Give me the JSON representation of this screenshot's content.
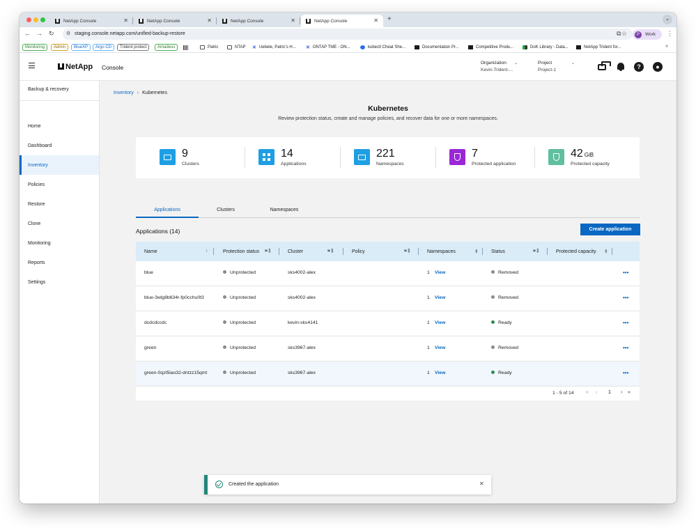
{
  "browser": {
    "tabs": [
      {
        "title": "NetApp Console"
      },
      {
        "title": "NetApp Console"
      },
      {
        "title": "NetApp Console"
      },
      {
        "title": "NetApp Console"
      }
    ],
    "url": "staging.console.netapp.com/unified-backup-restore",
    "profile_label": "Work",
    "profile_initial": "P",
    "bookmarks": [
      {
        "label": "Monitoring",
        "color": "#2e7d32"
      },
      {
        "label": "Admin",
        "color": "#b8860b"
      },
      {
        "label": "BlueXP",
        "color": "#1565c0"
      },
      {
        "label": "Argo CD",
        "color": "#1565c0"
      },
      {
        "label": "Trident protect",
        "color": "#444444"
      },
      {
        "label": "Amadeus",
        "color": "#2e7d32"
      },
      {
        "label": "Patric",
        "icon": "folder-icon"
      },
      {
        "label": "NTAP",
        "icon": "folder-icon"
      },
      {
        "label": "Uebele, Patric's H...",
        "icon": "x-logo-icon"
      },
      {
        "label": "ONTAP TME - ON...",
        "icon": "x-logo-icon"
      },
      {
        "label": "kubectl Cheat She...",
        "icon": "kubernetes-icon"
      },
      {
        "label": "Documentation Pr...",
        "icon": "netapp-icon"
      },
      {
        "label": "Competitive Produ...",
        "icon": "netapp-icon"
      },
      {
        "label": "DoK Library - Data...",
        "icon": "dok-icon"
      },
      {
        "label": "NetApp Trident for...",
        "icon": "netapp-icon"
      }
    ]
  },
  "header": {
    "logo": "NetApp",
    "product": "Console",
    "organization_label": "Organization",
    "organization_value": "Kevin-Trident-...",
    "project_label": "Project",
    "project_value": "Project-1"
  },
  "sidebar": {
    "title": "Backup & recovery",
    "items": [
      {
        "label": "Home"
      },
      {
        "label": "Dashboard"
      },
      {
        "label": "Inventory",
        "active": true
      },
      {
        "label": "Policies"
      },
      {
        "label": "Restore"
      },
      {
        "label": "Clone"
      },
      {
        "label": "Monitoring"
      },
      {
        "label": "Reports"
      },
      {
        "label": "Settings"
      }
    ]
  },
  "breadcrumb": {
    "parent": "Inventory",
    "current": "Kubernetes"
  },
  "page": {
    "title": "Kubernetes",
    "subtitle": "Review protection status, create and manage policies, and recover data for one or more namespaces."
  },
  "stats": [
    {
      "value": "9",
      "unit": "",
      "label": "Clusters",
      "color": "#1e9fe3",
      "icon": "cluster-icon"
    },
    {
      "value": "14",
      "unit": "",
      "label": "Applications",
      "color": "#1e9fe3",
      "icon": "applications-icon"
    },
    {
      "value": "221",
      "unit": "",
      "label": "Namespaces",
      "color": "#1e9fe3",
      "icon": "namespace-icon"
    },
    {
      "value": "7",
      "unit": "",
      "label": "Protected application",
      "color": "#9c27d6",
      "icon": "shield-icon"
    },
    {
      "value": "42",
      "unit": "GiB",
      "label": "Protected capacity",
      "color": "#5fbf9f",
      "icon": "shield-icon"
    }
  ],
  "tabs": [
    {
      "label": "Applications",
      "active": true
    },
    {
      "label": "Clusters"
    },
    {
      "label": "Namespaces"
    }
  ],
  "applications": {
    "title": "Applications (14)",
    "create_label": "Create application",
    "columns": [
      "Name",
      "Protection status",
      "Cluster",
      "Policy",
      "Namespaces",
      "Status",
      "Protected capacity"
    ],
    "rows": [
      {
        "name": "blue",
        "protection": "Unprotected",
        "cluster": "sks4002-alex",
        "policy": "",
        "namespaces": "1",
        "view": "View",
        "status": "Removed",
        "status_color": "#8a8a8a"
      },
      {
        "name": "blue-3wlg8b634r-fp0cchu0t3",
        "protection": "Unprotected",
        "cluster": "sks4002-alex",
        "policy": "",
        "namespaces": "1",
        "view": "View",
        "status": "Removed",
        "status_color": "#8a8a8a"
      },
      {
        "name": "dcdcdccdc",
        "protection": "Unprotected",
        "cluster": "kevin-sks4141",
        "policy": "",
        "namespaces": "1",
        "view": "View",
        "status": "Ready",
        "status_color": "#2e8b57"
      },
      {
        "name": "green",
        "protection": "Unprotected",
        "cluster": "sks3967-alex",
        "policy": "",
        "namespaces": "1",
        "view": "View",
        "status": "Removed",
        "status_color": "#8a8a8a"
      },
      {
        "name": "green-0qzt5iao32-dntzz15qmt",
        "protection": "Unprotected",
        "cluster": "sks3967-alex",
        "policy": "",
        "namespaces": "1",
        "view": "View",
        "status": "Ready",
        "status_color": "#2e8b57"
      }
    ],
    "pagination": {
      "range": "1 - 5 of 14",
      "page": "1"
    }
  },
  "toast": {
    "message": "Created the application"
  }
}
